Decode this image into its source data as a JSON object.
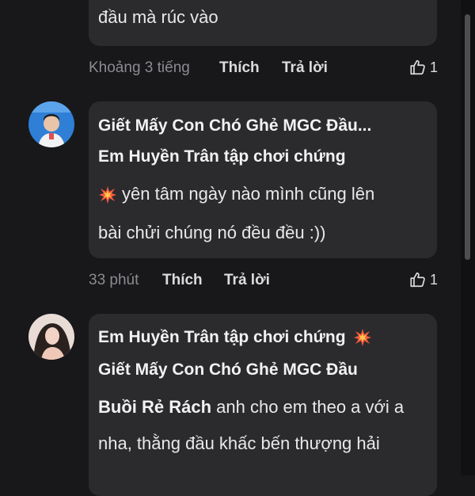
{
  "comments": [
    {
      "text_lines": [
        "đầu mà rúc vào"
      ],
      "time": "Khoảng 3 tiếng",
      "like_label": "Thích",
      "reply_label": "Trả lời",
      "like_count": "1"
    },
    {
      "author_line1": "Giết Mấy Con Chó Ghẻ MGC Đầu...",
      "author_line2": "Em Huyền Trân tập chơi chứng",
      "text_line1": "yên tâm ngày nào mình cũng lên",
      "text_line2": "bài chửi chúng nó đều đều :))",
      "time": "33 phút",
      "like_label": "Thích",
      "reply_label": "Trả lời",
      "like_count": "1"
    },
    {
      "author_line1": "Em Huyền Trân tập chơi chứng",
      "author_line2": "Giết Mấy Con Chó Ghẻ MGC Đầu",
      "mention_tail": "Buồi Rẻ Rách",
      "text_tail": "anh cho em theo a với a",
      "text_line2": "nha, thằng đầu khấc bến thượng hải"
    }
  ],
  "colors": {
    "background": "#18181b",
    "bubble": "#2b2b2e",
    "burst": "#ff5a3c"
  },
  "icons": {
    "like": "thumbs-up-icon",
    "emoji": "collision-emoji-icon"
  }
}
